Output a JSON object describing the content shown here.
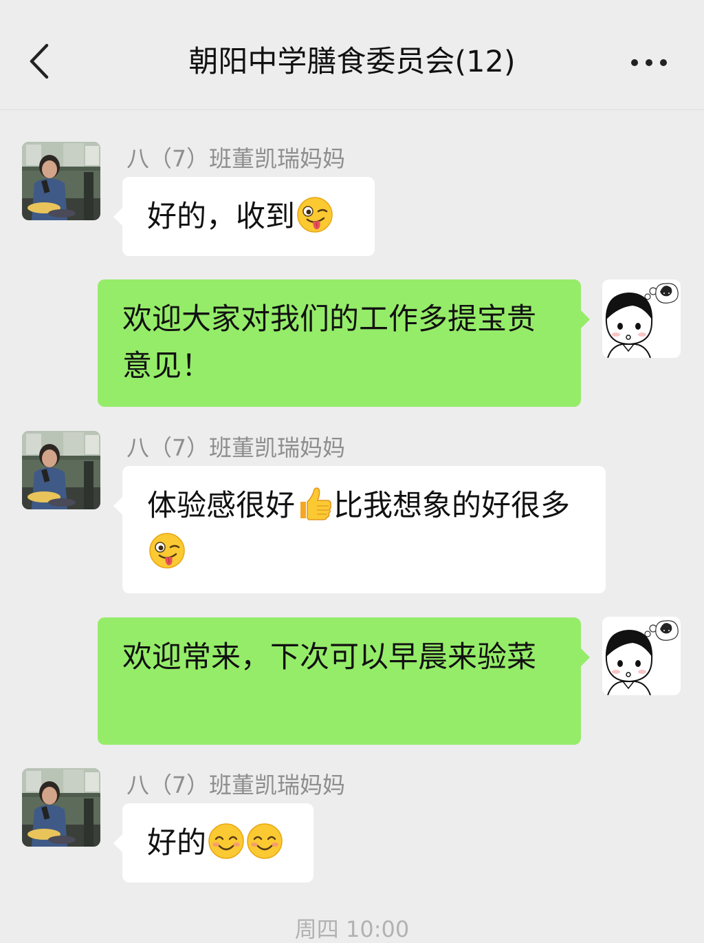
{
  "header": {
    "title": "朝阳中学膳食委员会(12)"
  },
  "messages": [
    {
      "sender": "八（7）班董凯瑞妈妈",
      "direction": "incoming",
      "text": "好的，收到",
      "emojis": [
        "wink-tongue-emoji"
      ]
    },
    {
      "direction": "outgoing",
      "text": "欢迎大家对我们的工作多提宝贵意见！"
    },
    {
      "sender": "八（7）班董凯瑞妈妈",
      "direction": "incoming",
      "text_before": "体验感很好",
      "text_after": "比我想象的好很多",
      "emojis": [
        "thumbs-up-emoji",
        "wink-tongue-emoji"
      ]
    },
    {
      "direction": "outgoing",
      "text": "欢迎常来，下次可以早晨来验菜"
    },
    {
      "sender": "八（7）班董凯瑞妈妈",
      "direction": "incoming",
      "text": "好的",
      "emojis": [
        "smile-emoji",
        "smile-emoji"
      ]
    }
  ],
  "timestamp": "周四 10:00",
  "colors": {
    "background": "#ededed",
    "outgoing_bubble": "#95ec69",
    "incoming_bubble": "#ffffff",
    "sender_name": "#8e8e8e"
  },
  "icons": {
    "back": "chevron-left-icon",
    "more": "more-dots-icon"
  }
}
